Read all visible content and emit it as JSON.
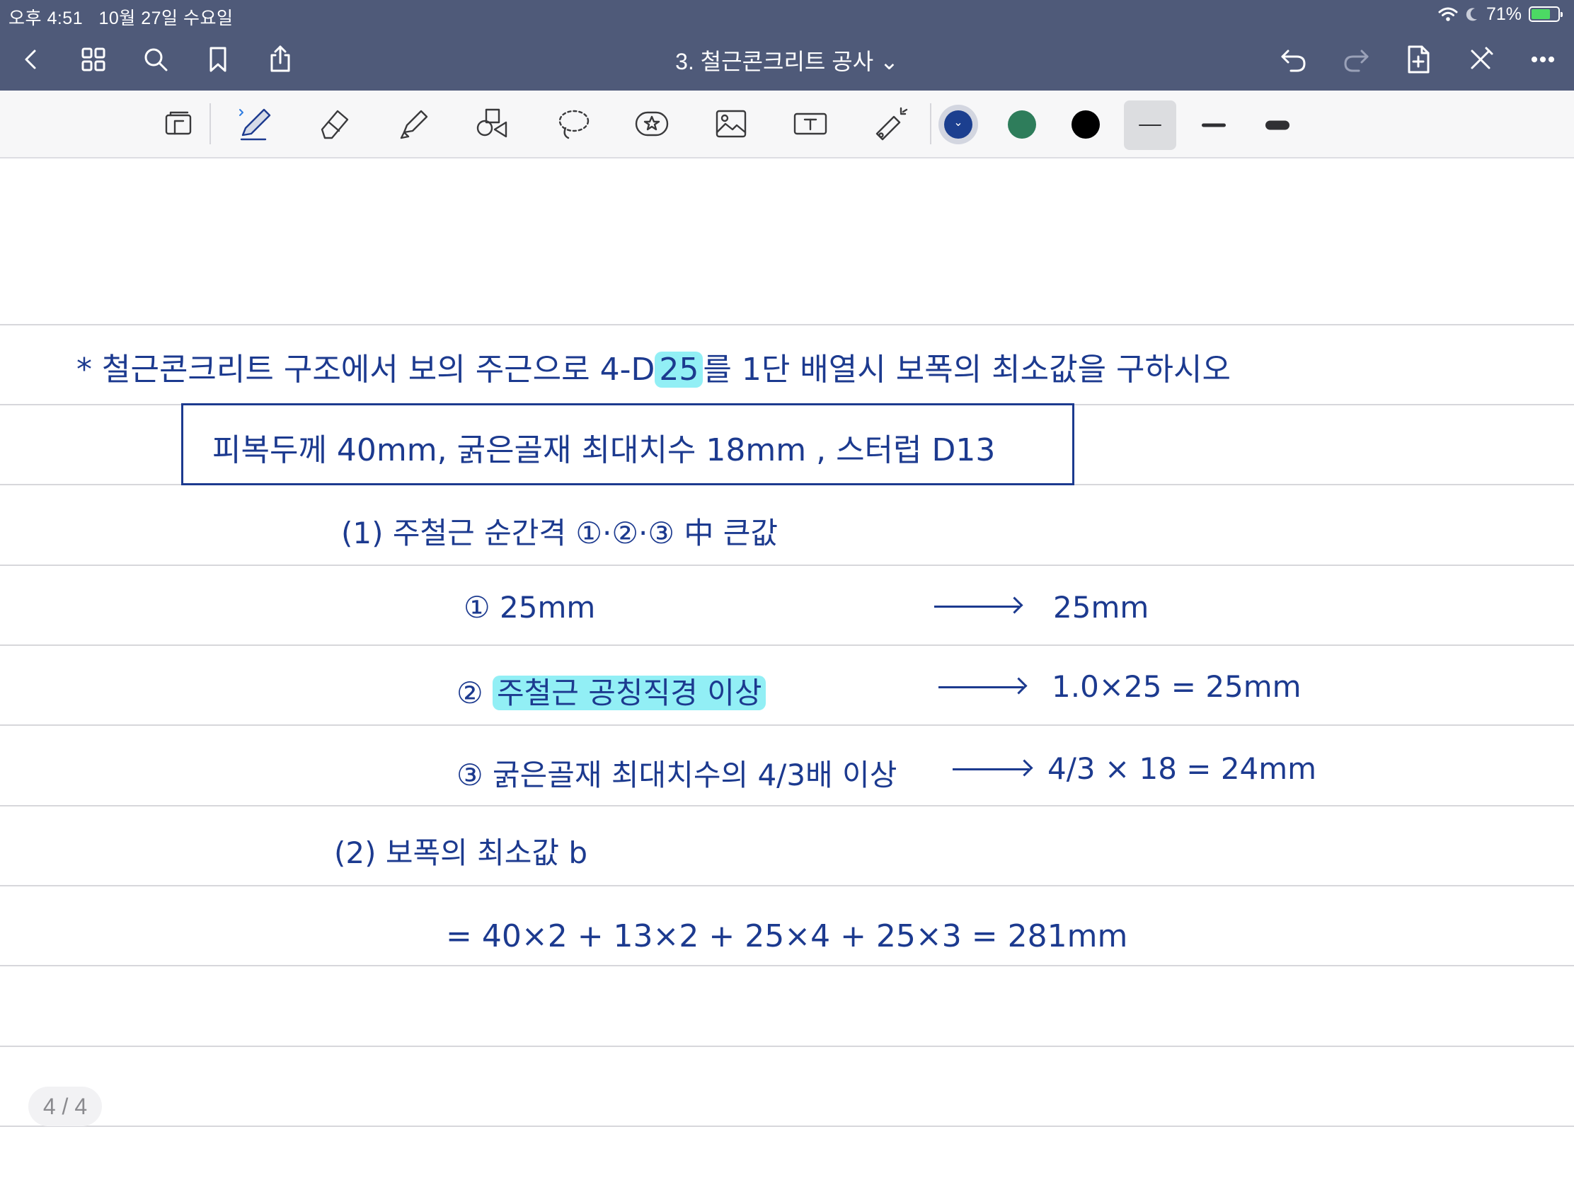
{
  "status_bar": {
    "time": "오후 4:51",
    "date": "10월 27일 수요일",
    "battery_percent": "71%",
    "battery_level": 0.71
  },
  "nav": {
    "title": "3. 철근콘크리트 공사",
    "title_chevron": "⌄",
    "icons": [
      "back-icon",
      "grid-icon",
      "search-icon",
      "bookmark-icon",
      "share-icon",
      "undo-icon",
      "redo-icon",
      "add-page-icon",
      "close-pen-icon",
      "more-icon"
    ]
  },
  "toolbar": {
    "tools": [
      "page-tool",
      "pen",
      "eraser",
      "highlighter",
      "shapes",
      "lasso",
      "sticker",
      "image",
      "text",
      "laser-pointer"
    ],
    "colors": [
      "#1c3f8f",
      "#2e7d5b",
      "#000000"
    ],
    "selected_color": "#1c3f8f"
  },
  "note": {
    "question": "* 철근콘크리트 구조에서 보의 주근으로 4-D25를 1단 배열시 보폭의 최소값을 구하시오",
    "question_prefix": "* 철근콘크리트 구조에서 보의 주근으로 4-D",
    "question_highlight": "25",
    "question_suffix": "를 1단 배열시 보폭의 최소값을 구하시오",
    "given": "피복두께 40mm, 굵은골재 최대치수 18mm , 스터럽 D13",
    "step1_heading": "(1) 주철근 순간격 ①·②·③ 中 큰값",
    "step1_item1_left": "① 25mm",
    "step1_item1_right": "25mm",
    "step1_item2_num": "②",
    "step1_item2_left": "주철근 공칭직경 이상",
    "step1_item2_right": "1.0×25 = 25mm",
    "step1_item3_left": "③ 굵은골재 최대치수의 4/3배 이상",
    "step1_item3_right": "4/3 × 18 = 24mm",
    "step2_heading": "(2) 보폭의 최소값 b",
    "step2_formula": "= 40×2 + 13×2 + 25×4 + 25×3 = 281mm"
  },
  "page_indicator": "4 / 4"
}
